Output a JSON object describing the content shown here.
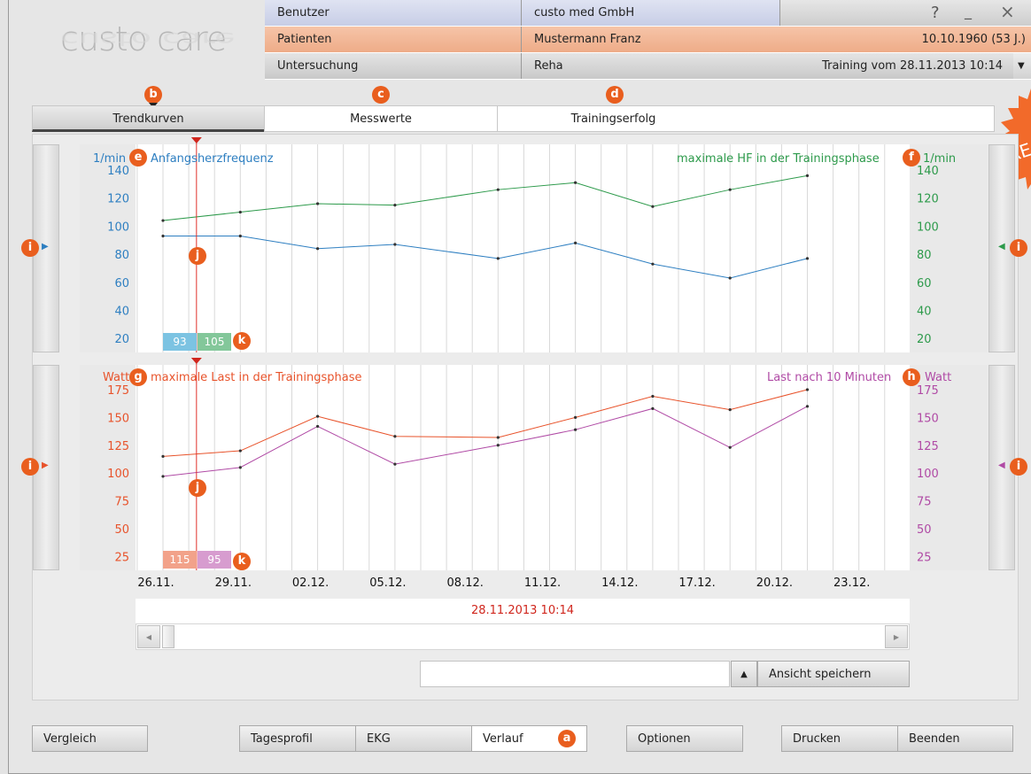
{
  "app": {
    "logo": "custo care"
  },
  "header": {
    "rows": [
      {
        "label": "Benutzer",
        "value": "custo med GmbH",
        "extra": ""
      },
      {
        "label": "Patienten",
        "value": "Mustermann Franz",
        "extra": "10.10.1960 (53 J.)"
      },
      {
        "label": "Untersuchung",
        "value": "Reha",
        "extra": "Training vom 28.11.2013 10:14"
      }
    ],
    "window_buttons": {
      "help": "?",
      "minimize": "_",
      "close": "×"
    },
    "dropdown_arrow": "▼"
  },
  "badges": {
    "a": "a",
    "b": "b",
    "c": "c",
    "d": "d",
    "e": "e",
    "f": "f",
    "g": "g",
    "h": "h",
    "i": "i",
    "j": "j",
    "k": "k"
  },
  "preview_stamp": "PRE",
  "tabs": [
    "Trendkurven",
    "Messwerte",
    "Trainingserfolg"
  ],
  "chart_data": [
    {
      "type": "line",
      "y_left_unit": "1/min",
      "y_right_unit": "1/min",
      "left_title": "Anfangsherzfrequenz",
      "right_title": "maximale HF  in der Trainingsphase",
      "y_ticks": [
        "140",
        "120",
        "100",
        "80",
        "60",
        "40",
        "20"
      ],
      "ylim": [
        10,
        140
      ],
      "x": [
        "26.11.",
        "29.11.",
        "02.12.",
        "05.12.",
        "08.12.",
        "11.12.",
        "14.12.",
        "17.12.",
        "20.12.",
        "23.12."
      ],
      "x_day_index": [
        0,
        3,
        6,
        9,
        12,
        15,
        18,
        21,
        24,
        27
      ],
      "series": [
        {
          "name": "Anfangsherzfrequenz",
          "color": "#2e7fc1",
          "days": [
            0,
            3,
            6,
            9,
            13,
            16,
            19,
            22,
            25
          ],
          "values": [
            93,
            93,
            84,
            87,
            77,
            88,
            73,
            63,
            77
          ]
        },
        {
          "name": "maximale HF  in der Trainingsphase",
          "color": "#2d9a4b",
          "days": [
            0,
            3,
            6,
            9,
            13,
            16,
            19,
            22,
            25
          ],
          "values": [
            104,
            110,
            116,
            115,
            126,
            131,
            114,
            126,
            136
          ]
        }
      ],
      "cursor_values": [
        "93",
        "105"
      ],
      "cursor_colors": [
        "#7cc3e2",
        "#83c79a"
      ]
    },
    {
      "type": "line",
      "y_left_unit": "Watt",
      "y_right_unit": "Watt",
      "left_title": "maximale Last in der Trainingsphase",
      "right_title": "Last nach 10 Minuten",
      "y_ticks": [
        "175",
        "150",
        "125",
        "100",
        "75",
        "50",
        "25"
      ],
      "ylim": [
        12.5,
        175
      ],
      "series": [
        {
          "name": "maximale Last in der Trainingsphase",
          "color": "#e8532b",
          "days": [
            0,
            3,
            6,
            9,
            13,
            16,
            19,
            22,
            25
          ],
          "values": [
            115,
            120,
            151,
            133,
            132,
            150,
            169,
            157,
            175
          ]
        },
        {
          "name": "Last nach 10 Minuten",
          "color": "#b04aa5",
          "days": [
            0,
            3,
            6,
            9,
            13,
            16,
            19,
            22,
            25
          ],
          "values": [
            97,
            105,
            142,
            108,
            125,
            139,
            158,
            123,
            160
          ]
        }
      ],
      "cursor_values": [
        "115",
        "95"
      ],
      "cursor_colors": [
        "#f2a28a",
        "#d79ccf"
      ]
    }
  ],
  "cursor_label": "28.11.2013 10:14",
  "scroll": {
    "left": "◀",
    "right": "▶"
  },
  "save_view": {
    "input_value": "",
    "arrow": "▲",
    "label": "Ansicht speichern"
  },
  "footer": {
    "vergleich": "Vergleich",
    "tagesprofil": "Tagesprofil",
    "ekg": "EKG",
    "verlauf": "Verlauf",
    "optionen": "Optionen",
    "drucken": "Drucken",
    "beenden": "Beenden"
  },
  "side_arrows": {
    "left": "▶",
    "right": "◀"
  }
}
